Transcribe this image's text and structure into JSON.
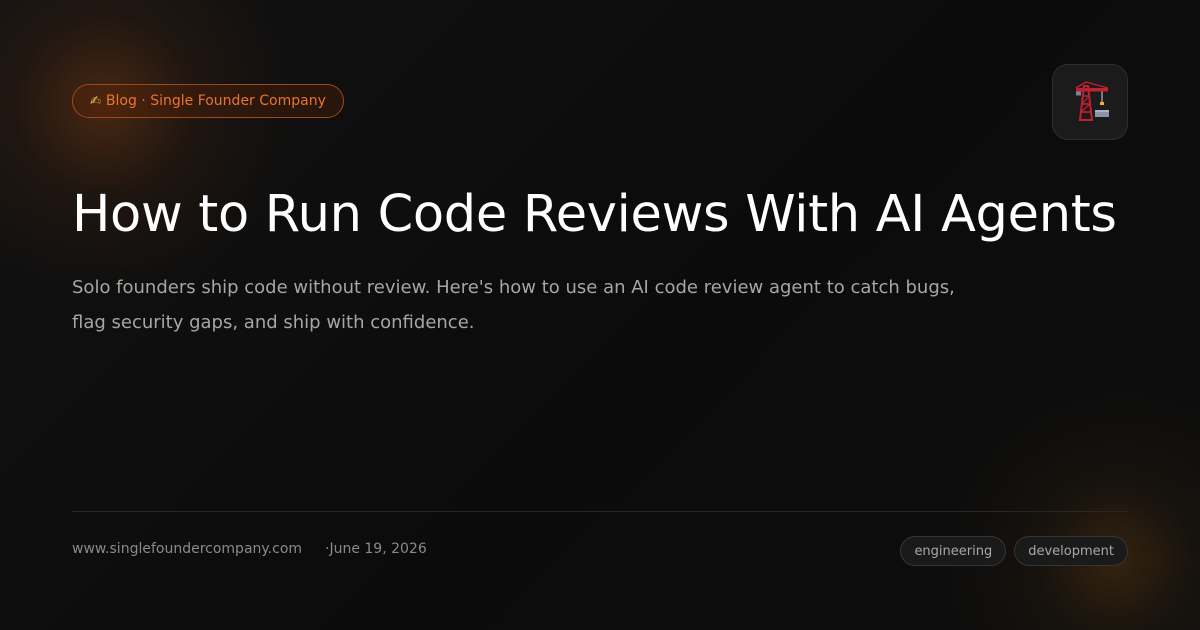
{
  "badge": {
    "icon": "writing-hand-icon",
    "icon_glyph": "✍",
    "label": "Blog · Single Founder Company"
  },
  "logo": {
    "icon": "construction-crane-icon"
  },
  "title": "How to Run Code Reviews With AI Agents",
  "description": "Solo founders ship code without review. Here's how to use an AI code review agent to catch bugs, flag security gaps, and ship with confidence.",
  "footer": {
    "url": "www.singlefoundercompany.com",
    "date": "·June 19, 2026"
  },
  "tags": [
    "engineering",
    "development"
  ],
  "colors": {
    "accent": "#e8742f",
    "background": "#0c0c0c",
    "title": "#ffffff",
    "muted": "#a6a6a6"
  }
}
